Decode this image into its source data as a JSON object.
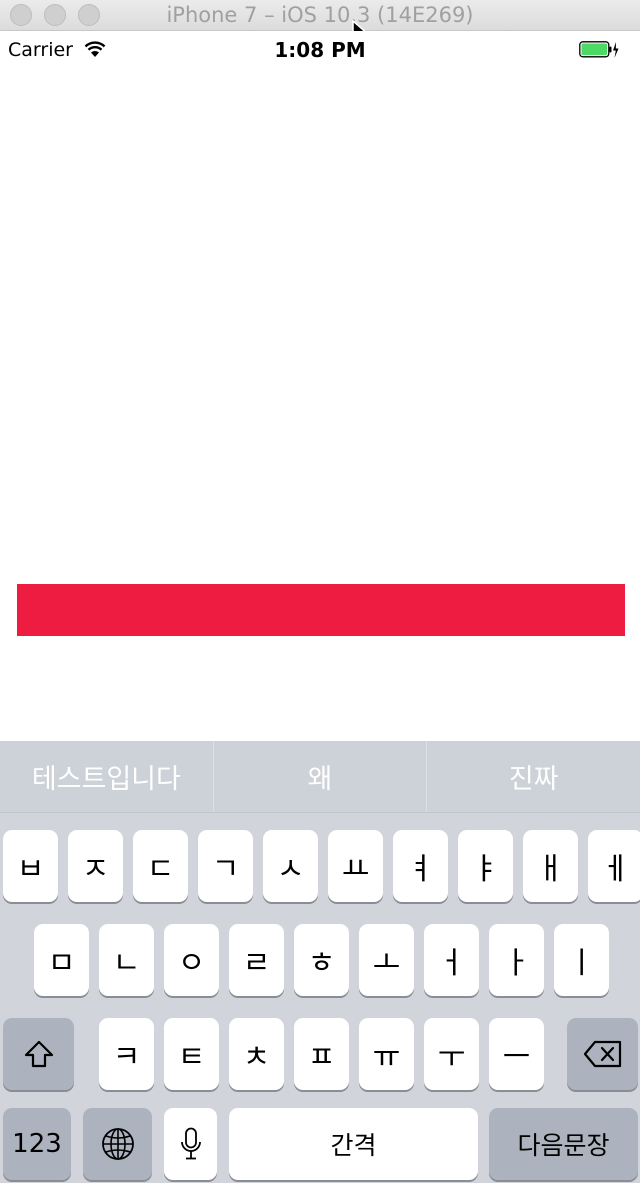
{
  "window": {
    "title": "iPhone 7 – iOS 10.3 (14E269)"
  },
  "status_bar": {
    "carrier": "Carrier",
    "time": "1:08 PM"
  },
  "colors": {
    "red_bar": "#ee1c40",
    "keyboard_bg": "#d1d4da",
    "function_key": "#acb3be"
  },
  "predictions": [
    "테스트입니다",
    "왜",
    "진짜"
  ],
  "keyboard": {
    "row1": [
      "ㅂ",
      "ㅈ",
      "ㄷ",
      "ㄱ",
      "ㅅ",
      "ㅛ",
      "ㅕ",
      "ㅑ",
      "ㅐ",
      "ㅔ"
    ],
    "row2": [
      "ㅁ",
      "ㄴ",
      "ㅇ",
      "ㄹ",
      "ㅎ",
      "ㅗ",
      "ㅓ",
      "ㅏ",
      "ㅣ"
    ],
    "row3": [
      "ㅋ",
      "ㅌ",
      "ㅊ",
      "ㅍ",
      "ㅠ",
      "ㅜ",
      "ㅡ"
    ],
    "numbers_label": "123",
    "space_label": "간격",
    "return_label": "다음문장",
    "icons": {
      "shift": "shift-icon",
      "delete": "delete-icon",
      "globe": "globe-icon",
      "mic": "microphone-icon"
    }
  }
}
